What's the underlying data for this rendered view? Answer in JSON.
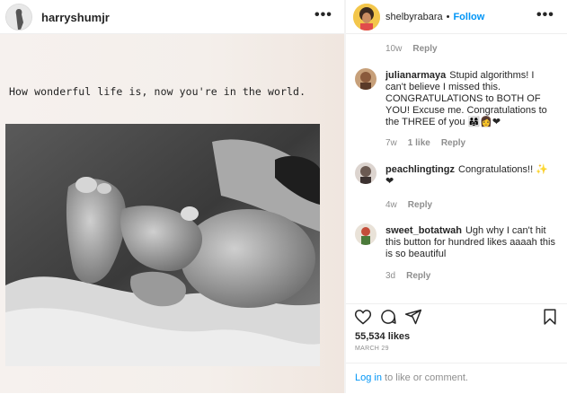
{
  "post_author": {
    "username": "harryshumjr"
  },
  "photo": {
    "caption": "How wonderful life is, now you're in the world."
  },
  "right_header": {
    "username": "shelbyrabara",
    "separator": "•",
    "follow_label": "Follow"
  },
  "comments": [
    {
      "username": "",
      "text": "",
      "time": "10w",
      "likes": "",
      "reply": "Reply"
    },
    {
      "username": "julianarmaya",
      "text": "Stupid algorithms! I can't believe I missed this. CONGRATULATIONS to BOTH OF YOU! Excuse me. Congratulations to the THREE of you 👨‍👩‍👧👩❤",
      "time": "7w",
      "likes": "1 like",
      "reply": "Reply"
    },
    {
      "username": "peachlingtingz",
      "text": "Congratulations!! ✨❤",
      "time": "4w",
      "likes": "",
      "reply": "Reply"
    },
    {
      "username": "sweet_botatwah",
      "text": "Ugh why I can't hit this button for hundred likes aaaah this is so beautiful",
      "time": "3d",
      "likes": "",
      "reply": "Reply"
    }
  ],
  "actions": {
    "likes_count": "55,534 likes",
    "date": "MARCH 29"
  },
  "login": {
    "link_text": "Log in",
    "rest_text": " to like or comment."
  },
  "icons": {
    "more": "more-dots-icon",
    "heart": "heart-icon",
    "comment": "comment-icon",
    "share": "share-icon",
    "save": "bookmark-icon"
  },
  "colors": {
    "accent": "#0095f6",
    "heart": "#ed4956"
  }
}
